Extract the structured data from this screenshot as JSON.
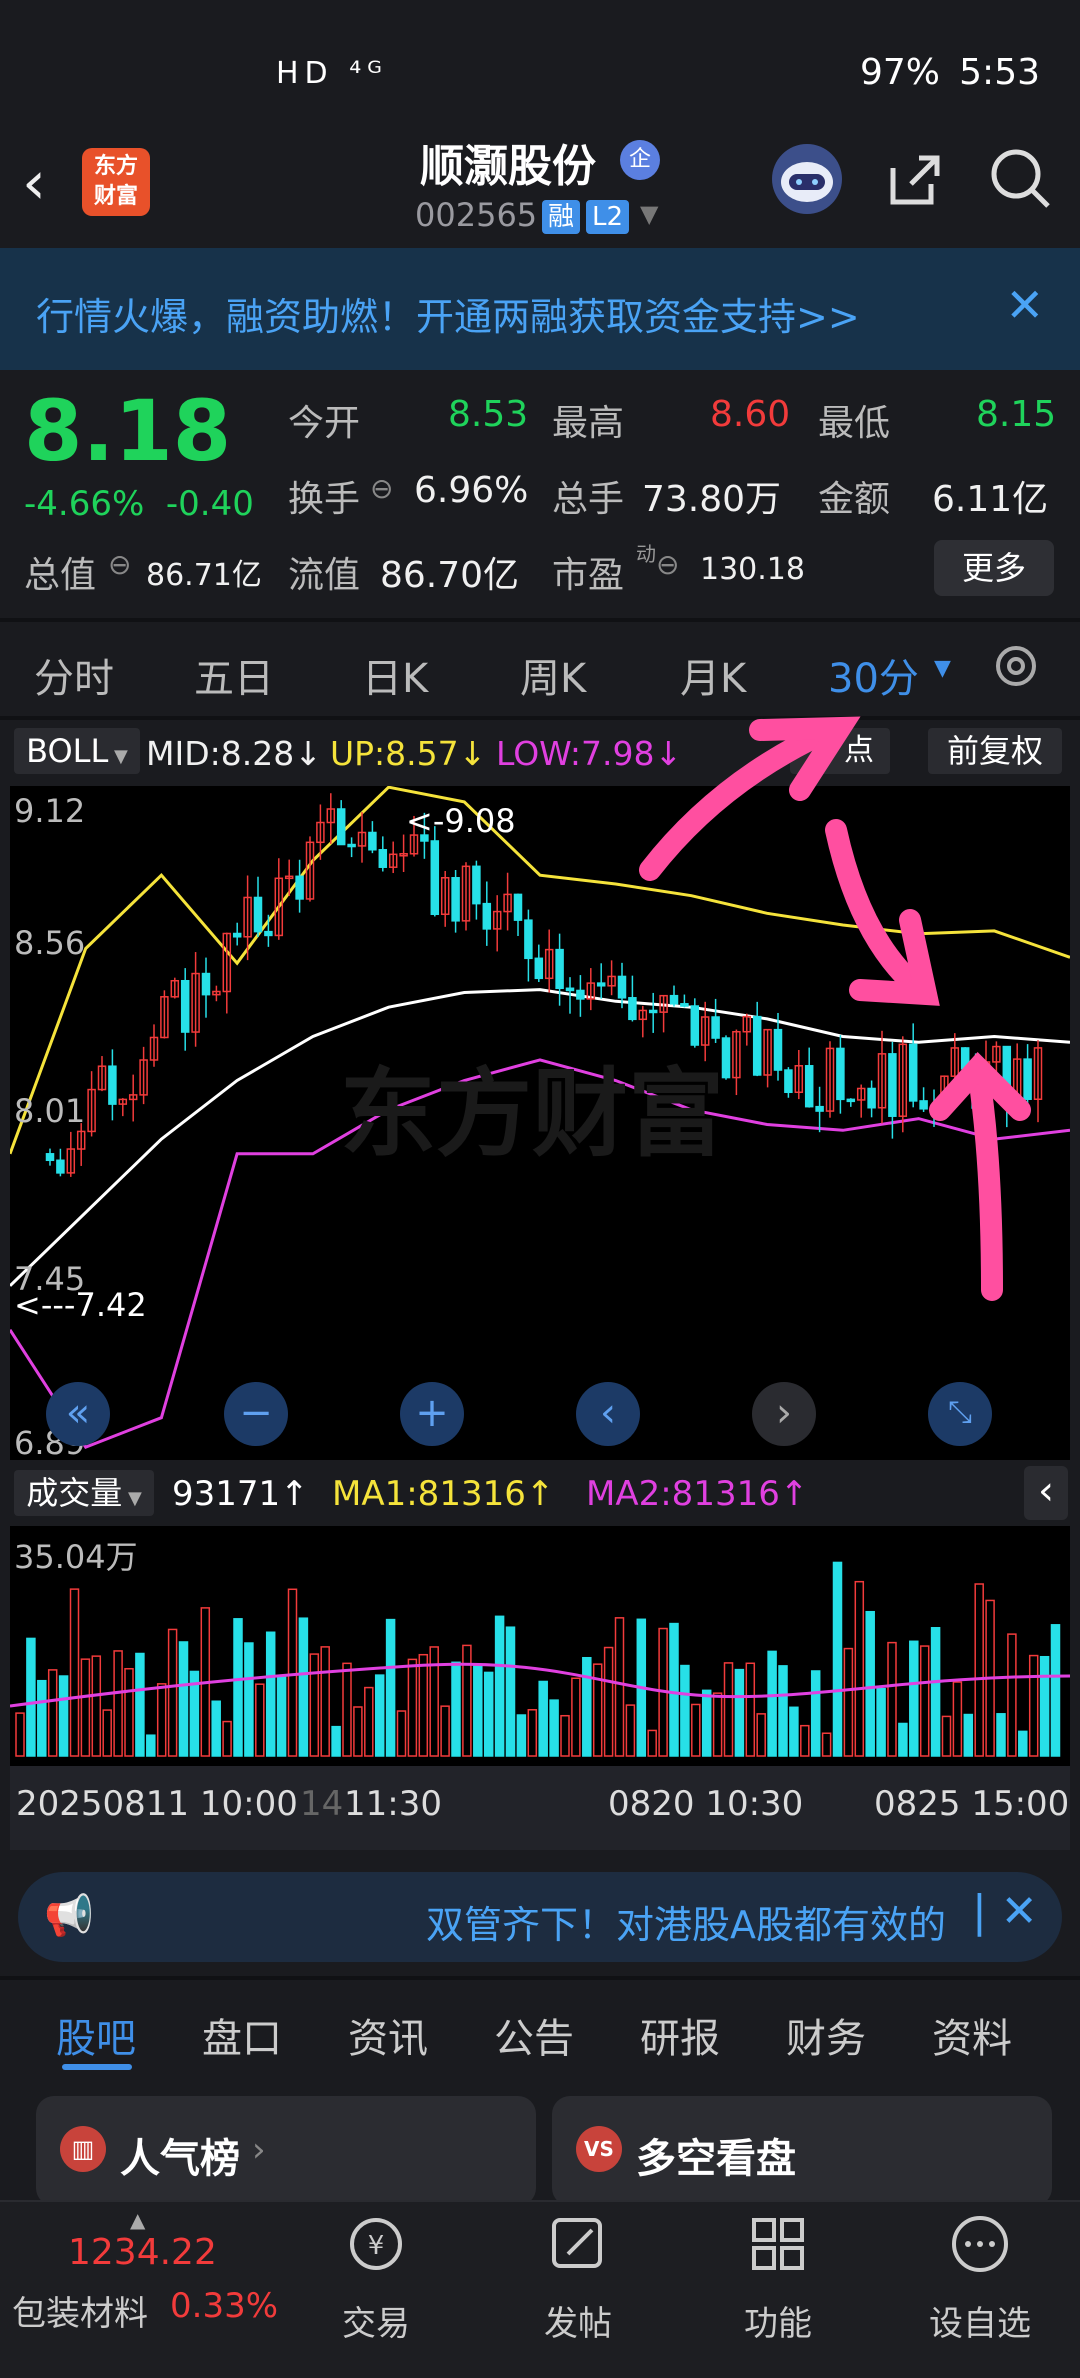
{
  "status_bar": {
    "icons": "HD ⁴ᴳ",
    "battery": "97%",
    "time": "5:53"
  },
  "header": {
    "logo_text": "东方\n财富",
    "title": "顺灏股份",
    "enterprise_badge": "企",
    "code": "002565",
    "tag_margin": "融",
    "tag_level": "L2"
  },
  "banner": {
    "text": "行情火爆，融资助燃！开通两融获取资金支持>>"
  },
  "quote": {
    "price": "8.18",
    "change_pct": "-4.66%",
    "change": "-0.40",
    "open_label": "今开",
    "open": "8.53",
    "high_label": "最高",
    "high": "8.60",
    "low_label": "最低",
    "low": "8.15",
    "turnover_label": "换手",
    "turnover": "6.96%",
    "volume_label": "总手",
    "volume": "73.80万",
    "amount_label": "金额",
    "amount": "6.11亿",
    "mktcap_label": "总值",
    "mktcap": "86.71亿",
    "float_label": "流值",
    "float": "86.70亿",
    "pe_label": "市盈",
    "pe_sup": "动",
    "pe": "130.18",
    "more": "更多"
  },
  "period_tabs": [
    "分时",
    "五日",
    "日K",
    "周K",
    "月K",
    "30分"
  ],
  "indicator": {
    "name": "BOLL",
    "mid": "MID:8.28↓",
    "up": "UP:8.57↓",
    "low": "LOW:7.98↓",
    "point_btn": "点",
    "adjust": "前复权"
  },
  "chart_data": {
    "type": "candlestick",
    "y_ticks": [
      "9.12",
      "8.56",
      "8.01",
      "7.45",
      "6.89"
    ],
    "annotations": [
      "<-9.08",
      "<---7.42"
    ],
    "ylim": [
      6.89,
      9.12
    ],
    "watermark": "东方财富"
  },
  "volume": {
    "name": "成交量",
    "value": "93171↑",
    "ma1": "MA1:81316↑",
    "ma2": "MA2:81316↑",
    "y_tick": "35.04万"
  },
  "x_axis": [
    "20250811 10:00",
    "14",
    "11:30",
    "0820 10:30",
    "0825 15:00"
  ],
  "ticker": {
    "text": "双管齐下！对港股A股都有效的"
  },
  "bottom_tabs": [
    "股吧",
    "盘口",
    "资讯",
    "公告",
    "研报",
    "财务",
    "资料"
  ],
  "cards": [
    {
      "label": "人气榜"
    },
    {
      "label": "多空看盘"
    }
  ],
  "nav": {
    "index_value": "1234.22",
    "index_name": "包装材料",
    "index_change": "0.33%",
    "items": [
      "交易",
      "发帖",
      "功能",
      "设自选"
    ]
  },
  "colors": {
    "up": "#f23b3b",
    "down": "#1fd35b",
    "accent": "#3f8fe8",
    "mid_line": "#ffffff",
    "upper_line": "#f5e33b",
    "lower_line": "#e040e0"
  }
}
